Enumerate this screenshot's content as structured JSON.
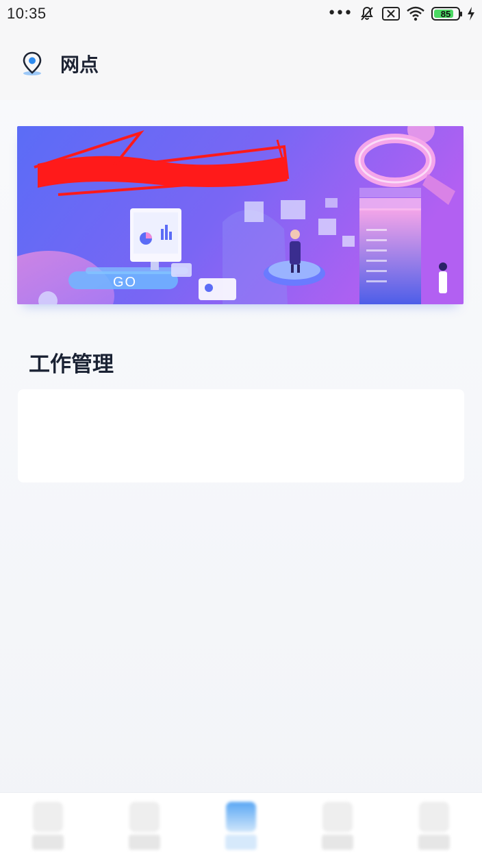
{
  "status_bar": {
    "time": "10:35",
    "battery_level": "85",
    "battery_fraction": 0.85,
    "icons": [
      "more-dots-icon",
      "mute-icon",
      "sim-x-icon",
      "wifi-icon",
      "battery-icon",
      "charging-icon"
    ]
  },
  "header": {
    "icon": "location-pin-icon",
    "title": "网点"
  },
  "banner": {
    "go_label": "GO"
  },
  "work_section": {
    "title": "工作管理"
  },
  "tab_bar": {
    "active_index": 2,
    "tabs": [
      {
        "icon": "tab-icon-1"
      },
      {
        "icon": "tab-icon-2"
      },
      {
        "icon": "tab-icon-3"
      },
      {
        "icon": "tab-icon-4"
      },
      {
        "icon": "tab-icon-5"
      }
    ]
  },
  "colors": {
    "accent": "#2f8cf0",
    "banner_left": "#5b6cf6",
    "banner_right": "#b260f2",
    "battery_green": "#4cd964"
  }
}
